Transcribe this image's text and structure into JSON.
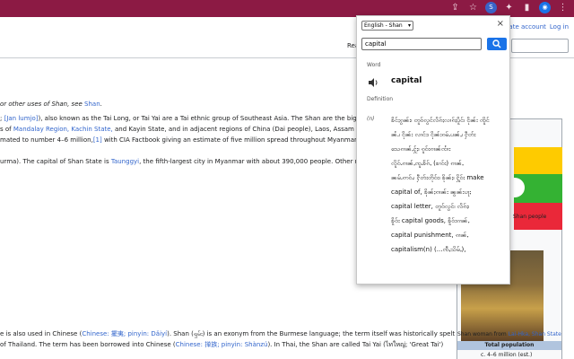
{
  "chrome": {
    "icons": [
      "share-icon",
      "star-icon",
      "extension-dict-icon",
      "puzzle-icon",
      "sidebar-icon",
      "profile-icon",
      "menu-icon"
    ]
  },
  "wiki": {
    "account": {
      "create": "Create account",
      "login": "Log in"
    },
    "tab_read": "Rea",
    "lines": [
      {
        "t": "or other uses of Shan, see ",
        "l": "Shan",
        "e": "."
      },
      {
        "t": "; ",
        "l": "[Jan lumjo]",
        "e": "), also known as the Tai Long, or Tai Yai are a Tai ethnic group of Southeast Asia. The Shan are the biggest mino"
      },
      {
        "t": "s of ",
        "l": "Mandalay Region, Kachin State,",
        "e": " and Kayin State, and in adjacent regions of China (Dai people), Laos, Assam (Ahom people"
      },
      {
        "t": "mated to number 4–6 million,",
        "l": "[1]",
        "e": " with CIA Factbook giving an estimate of five million spread throughout Myanmar which is about"
      },
      {
        "t": "urma). The capital of Shan State is ",
        "l": "Taunggyi",
        "e": ", the fifth-largest city in Myanmar with about 390,000 people. Other major cities inclu"
      },
      {
        "t": "e is also used in Chinese (",
        "l": "Chinese: 擺夷; pinyin: Dǎiyí",
        "e": "). Shan (ရှမ်း) is an exonym from the Burmese language; the term itself was historically spelt သျှမ်း"
      },
      {
        "t": "of Thailand. The term has been borrowed into Chinese (",
        "l": "Chinese: 掸族; pinyin: Shànzú",
        "e": "). In Thai, the Shan are called Tai Yai (ไทใหญ่; 'Great Tai')"
      }
    ],
    "infobox": {
      "caption1": "Shan people",
      "caption2_pre": "Shan woman from ",
      "caption2_link": "Lai-Hka, Shan State",
      "total_population": "Total population",
      "population_value": "c. 4–6 million (est.)"
    }
  },
  "popup": {
    "language": "English - Shan",
    "search_value": "capital",
    "word_label": "Word",
    "word": "capital",
    "definition_label": "Definition",
    "pos": "(n)",
    "definition_lines": [
      "ၶိင်ႈၵွၼ်း၊ တူဝ်လွင်လိၵ်ႈလၢၵ်ႈပိူင်၊ ငိုၼ်း ၸိူင်",
      "ၼႆႉ၊ ငိုၼ်း လၢင်း၊ ငိုၼ်းၵမ်ႉပၼ်ႇ၊ ႁဵတ်း",
      "သေၵၢၼ်ႇႁႂ်ႈ၊ ၵူဝ်းၵၢၼ်ၸၢႆး",
      "လိူဝ်ႉၵၢၼ်ႇၸူႉၶႅၵ်ႇ (ၶၢဝ်း) ၵၢၼ်ႇ",
      "ၼမ်ႉဢဝ်ႉ၊ ႁဵတ်းတိုဝ်း၊ ၶိုၼ်ႈ၊ ႁိူဝ်း make",
      "capital of, ၶိုၼ်ႈၵၢၼ်း ၼွၼ်းပႃႈ",
      "capital letter, တူဝ်လွင်၊ လိၵ်ႈ၊",
      "ၶိူဝ်း capital goods, ၶိူဝ်းၵၢၼ်ႇ",
      "capital punishment, ၵၢၼ်ႇ",
      "capitalism(n) (...ၸီႇသိမ်ႇ),"
    ]
  }
}
